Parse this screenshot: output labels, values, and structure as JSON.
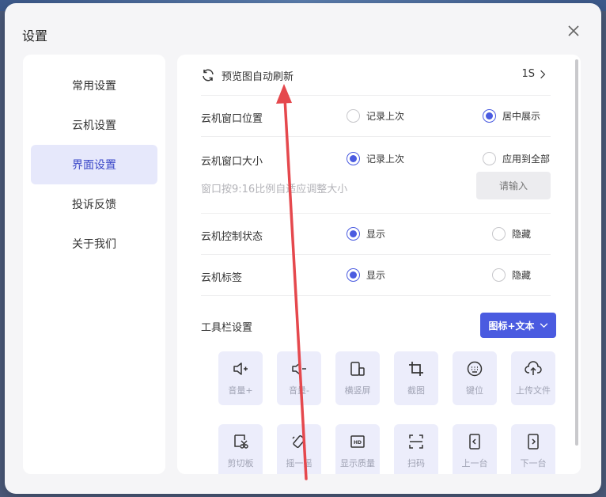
{
  "dialog": {
    "title": "设置"
  },
  "sidebar": {
    "items": [
      {
        "label": "常用设置",
        "active": false
      },
      {
        "label": "云机设置",
        "active": false
      },
      {
        "label": "界面设置",
        "active": true
      },
      {
        "label": "投诉反馈",
        "active": false
      },
      {
        "label": "关于我们",
        "active": false
      }
    ]
  },
  "main": {
    "preview_refresh": {
      "label": "预览图自动刷新",
      "value": "1S"
    },
    "window_position": {
      "label": "云机窗口位置",
      "option_a": "记录上次",
      "option_b": "居中展示",
      "selected": "居中展示"
    },
    "window_size": {
      "label": "云机窗口大小",
      "option_a": "记录上次",
      "option_b": "应用到全部",
      "selected": "记录上次",
      "hint": "窗口按9:16比例自适应调整大小",
      "input_placeholder": "请输入"
    },
    "control_status": {
      "label": "云机控制状态",
      "option_a": "显示",
      "option_b": "隐藏",
      "selected": "显示"
    },
    "tags": {
      "label": "云机标签",
      "option_a": "显示",
      "option_b": "隐藏",
      "selected": "显示"
    },
    "toolbar": {
      "label": "工具栏设置",
      "style_value": "图标+文本",
      "tools": [
        {
          "label": "音量+",
          "icon": "volume-up-icon"
        },
        {
          "label": "音量-",
          "icon": "volume-down-icon"
        },
        {
          "label": "横竖屏",
          "icon": "rotate-screen-icon"
        },
        {
          "label": "截图",
          "icon": "crop-icon"
        },
        {
          "label": "键位",
          "icon": "keyboard-icon"
        },
        {
          "label": "上传文件",
          "icon": "upload-icon"
        },
        {
          "label": "剪切板",
          "icon": "clipboard-icon"
        },
        {
          "label": "摇一摇",
          "icon": "shake-icon"
        },
        {
          "label": "显示质量",
          "icon": "hd-icon"
        },
        {
          "label": "扫码",
          "icon": "scan-icon"
        },
        {
          "label": "上一台",
          "icon": "prev-device-icon"
        },
        {
          "label": "下一台",
          "icon": "next-device-icon"
        }
      ]
    }
  },
  "colors": {
    "accent": "#4a5be0",
    "annotation_arrow": "#e5484d",
    "active_bg": "#e6e8fb"
  }
}
